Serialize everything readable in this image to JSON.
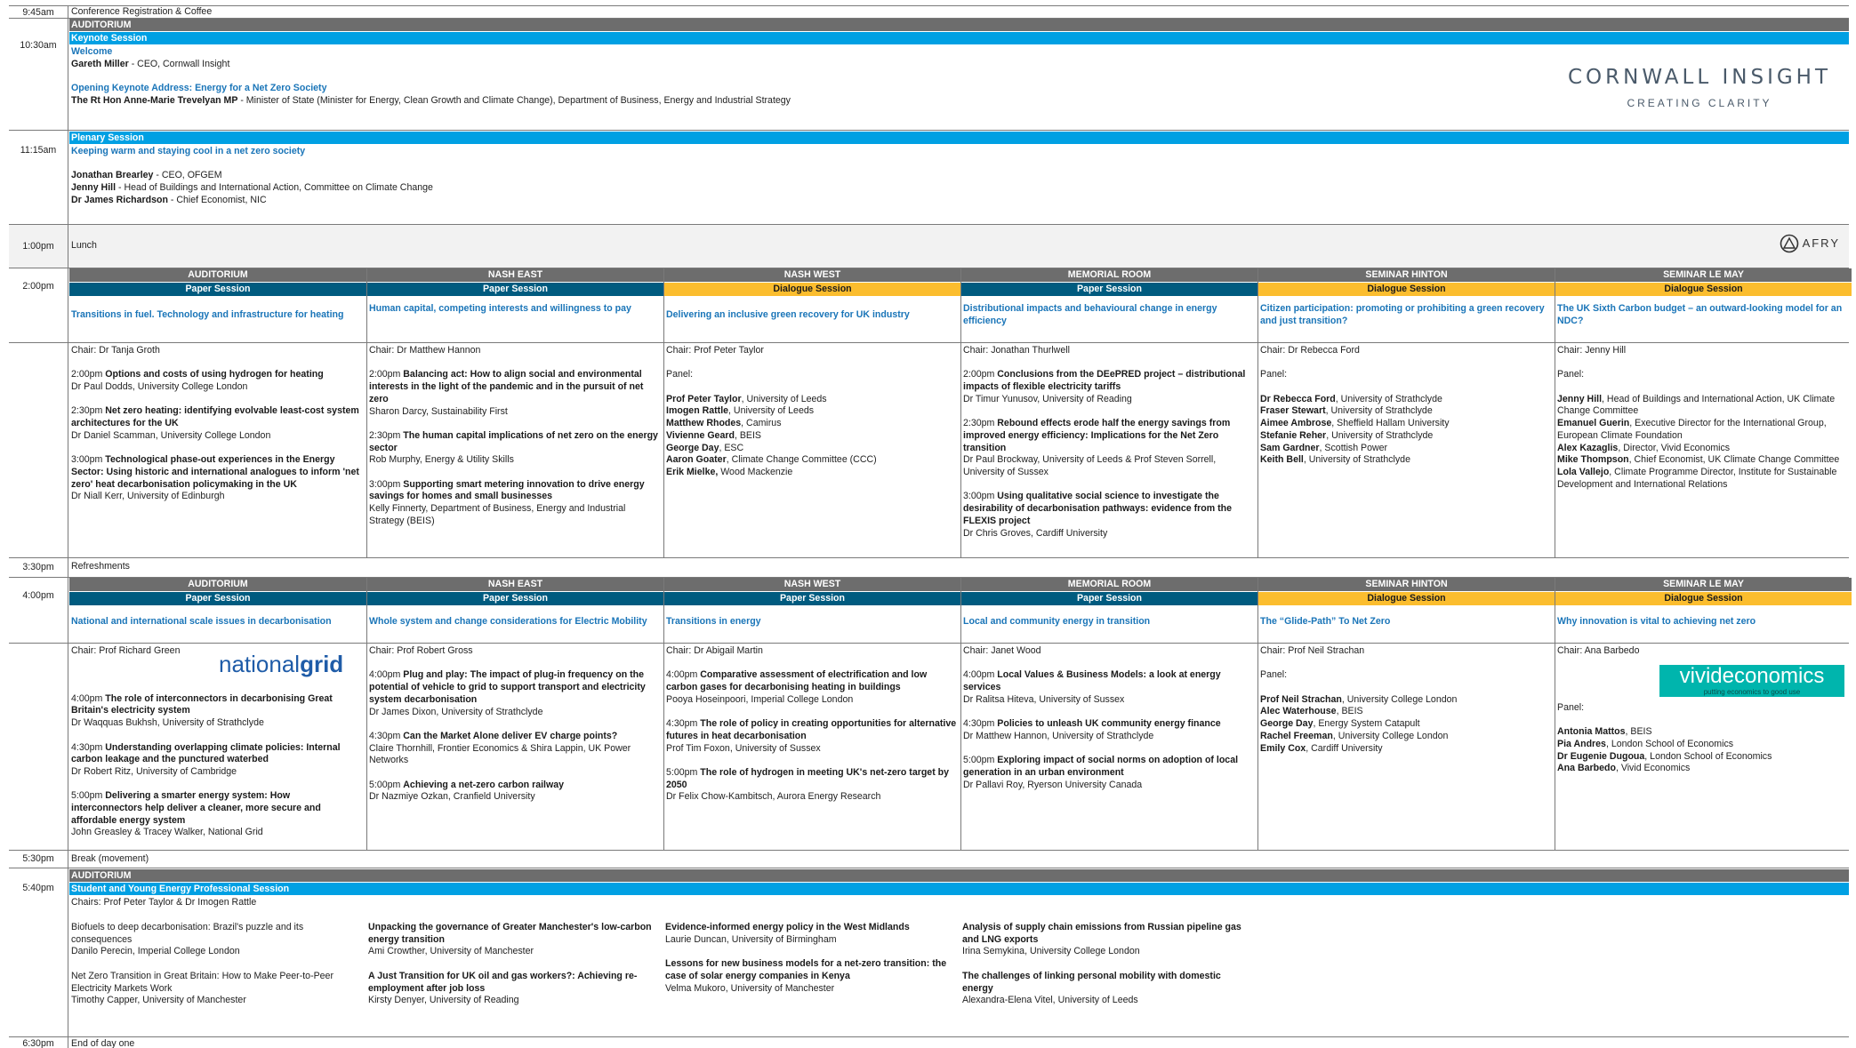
{
  "colors": {
    "grey": "#6d6d6d",
    "blue": "#00a0e3",
    "teal": "#005b7f",
    "gold": "#fbbd2e",
    "title_blue": "#1a75b8"
  },
  "logos": {
    "cornwall": {
      "line1": "CORNWALL INSIGHT",
      "line2": "CREATING CLARITY"
    },
    "afry": "AFRY",
    "nationalgrid": {
      "a": "national",
      "b": "grid"
    },
    "vivid": {
      "a": "vivideconomics",
      "b": "putting economics to good use"
    }
  },
  "times": [
    "9:45am",
    "10:30am",
    "11:15am",
    "1:00pm",
    "2:00pm",
    "3:30pm",
    "4:00pm",
    "5:30pm",
    "5:40pm",
    "6:30pm"
  ],
  "simple": {
    "registration": "Conference Registration & Coffee",
    "lunch": "Lunch",
    "refreshments": "Refreshments",
    "break": "Break (movement)",
    "end": "End of day one"
  },
  "keynote": {
    "room": "AUDITORIUM",
    "session": "Keynote Session",
    "welcome": "Welcome",
    "s1_name": "Gareth Miller",
    "s1_role": " - CEO, Cornwall Insight",
    "address": "Opening Keynote Address: Energy for a Net Zero Society",
    "s2_name": "The Rt Hon Anne-Marie Trevelyan MP",
    "s2_role": " - Minister of State (Minister for Energy, Clean Growth and Climate Change), Department of Business, Energy and Industrial Strategy"
  },
  "plenary": {
    "session": "Plenary Session",
    "title": "Keeping warm and staying cool in a net zero society",
    "p1_name": "Jonathan Brearley",
    "p1_role": " - CEO, OFGEM",
    "p2_name": "Jenny Hill",
    "p2_role": " - Head of Buildings and International Action, Committee on Climate Change",
    "p3_name": "Dr James Richardson",
    "p3_role": " - Chief Economist, NIC"
  },
  "rooms": [
    "AUDITORIUM",
    "NASH EAST",
    "NASH WEST",
    "MEMORIAL ROOM",
    "SEMINAR HINTON",
    "SEMINAR LE MAY"
  ],
  "s2": {
    "types": [
      "Paper Session",
      "Paper Session",
      "Dialogue Session",
      "Paper Session",
      "Dialogue Session",
      "Dialogue Session"
    ],
    "titles": [
      "Transitions in fuel. Technology and infrastructure for heating",
      "Human capital, competing interests and willingness to pay",
      "Delivering an inclusive green recovery for UK industry",
      "Distributional impacts and behavioural change in energy efficiency",
      "Citizen participation: promoting or prohibiting a green recovery and just transition?",
      "The UK Sixth Carbon budget – an outward-looking model for an NDC?"
    ],
    "c0": {
      "chair": "Chair: Dr Tanja Groth",
      "a1": "2:00pm ",
      "a1b": "Options and costs of using hydrogen for heating",
      "a1s": "Dr Paul Dodds, University College London",
      "a2": "2:30pm ",
      "a2b": "Net zero heating: identifying evolvable least-cost system architectures for the UK",
      "a2s": "Dr Daniel Scamman, University College London",
      "a3": "3:00pm ",
      "a3b": "Technological phase-out experiences in the Energy Sector: Using historic and international analogues to inform 'net zero' heat decarbonisation policymaking in the UK",
      "a3s": "Dr Niall Kerr, University of Edinburgh"
    },
    "c1": {
      "chair": "Chair: Dr Matthew Hannon",
      "a1": "2:00pm ",
      "a1b": "Balancing act: How to align social and environmental interests in the light of the pandemic and in the pursuit of net zero",
      "a1s": "Sharon Darcy, Sustainability First",
      "a2": "2:30pm ",
      "a2b": "The human capital implications of net zero on the energy sector",
      "a2s": "Rob Murphy, Energy & Utility Skills",
      "a3": "3:00pm ",
      "a3b": "Supporting smart metering innovation to drive energy savings for homes and small businesses",
      "a3s": "Kelly Finnerty, Department of Business, Energy and Industrial Strategy (BEIS)"
    },
    "c2": {
      "chair": "Chair: Prof Peter Taylor",
      "panel": "Panel:",
      "m": [
        [
          "Prof Peter Taylor",
          ", University of Leeds"
        ],
        [
          "Imogen Rattle",
          ", University of Leeds"
        ],
        [
          "Matthew Rhodes",
          ", Camirus"
        ],
        [
          "Vivienne Geard",
          ", BEIS"
        ],
        [
          "George Day",
          ", ESC"
        ],
        [
          "Aaron Goater",
          ", Climate Change Committee (CCC)"
        ],
        [
          "Erik Mielke,",
          " Wood Mackenzie"
        ]
      ]
    },
    "c3": {
      "chair": "Chair: Jonathan Thurlwell",
      "a1": "2:00pm ",
      "a1b": "Conclusions from the DEePRED project – distributional impacts of flexible electricity tariffs",
      "a1s": "Dr Timur Yunusov, University of Reading",
      "a2": "2:30pm ",
      "a2b": "Rebound effects erode half the energy savings from improved energy efficiency: Implications for the Net Zero transition",
      "a2s": "Dr Paul Brockway, University of Leeds & Prof Steven Sorrell, University of Sussex",
      "a3": "3:00pm ",
      "a3b": "Using qualitative social science to investigate the desirability of decarbonisation pathways: evidence from the FLEXIS project",
      "a3s": "Dr Chris Groves, Cardiff University"
    },
    "c4": {
      "chair": "Chair: Dr Rebecca Ford",
      "panel": "Panel:",
      "m": [
        [
          "Dr Rebecca Ford",
          ", University of Strathclyde"
        ],
        [
          "Fraser Stewart",
          ", University of Strathclyde"
        ],
        [
          "Aimee Ambrose",
          ", Sheffield Hallam University"
        ],
        [
          "Stefanie Reher",
          ", University of Strathclyde"
        ],
        [
          "Sam Gardner",
          ", Scottish Power"
        ],
        [
          "Keith Bell",
          ", University of Strathclyde"
        ]
      ]
    },
    "c5": {
      "chair": "Chair: Jenny Hill",
      "panel": "Panel:",
      "m": [
        [
          "Jenny Hill",
          ", Head of Buildings and International Action, UK Climate Change Committee"
        ],
        [
          "Emanuel Guerin",
          ", Executive Director for the International Group, European Climate Foundation"
        ],
        [
          "Alex Kazaglis",
          ", Director, Vivid Economics"
        ],
        [
          "Mike Thompson",
          ", Chief Economist, UK Climate Change Committee"
        ],
        [
          "Lola Vallejo",
          ", Climate Programme Director, Institute for Sustainable Development and International Relations"
        ]
      ]
    }
  },
  "s4": {
    "types": [
      "Paper Session",
      "Paper Session",
      "Paper Session",
      "Paper Session",
      "Dialogue Session",
      "Dialogue Session"
    ],
    "titles": [
      "National and international scale issues in decarbonisation",
      "Whole system and change considerations for Electric Mobility",
      "Transitions in energy",
      "Local and community energy in transition",
      "The “Glide-Path” To Net Zero",
      "Why innovation is vital to achieving net zero"
    ],
    "c0": {
      "chair": "Chair: Prof Richard Green",
      "a1": "4:00pm ",
      "a1b": "The role of interconnectors in decarbonising Great Britain's electricity system",
      "a1s": "Dr Waqquas Bukhsh, University of Strathclyde",
      "a2": "4:30pm ",
      "a2b": "Understanding overlapping climate policies: Internal carbon leakage and the punctured waterbed",
      "a2s": "Dr Robert Ritz, University of Cambridge",
      "a3": "5:00pm ",
      "a3b": "Delivering a smarter energy system: How interconnectors help deliver a cleaner, more secure and affordable energy system",
      "a3s": "John Greasley & Tracey Walker, National Grid"
    },
    "c1": {
      "chair": "Chair: Prof Robert Gross",
      "a1": "4:00pm ",
      "a1b": "Plug and play: The impact of plug-in frequency on the potential of vehicle to grid to support transport and electricity system decarbonisation",
      "a1s": "Dr James Dixon, University of Strathclyde",
      "a2": "4:30pm ",
      "a2b": "Can the Market Alone deliver EV charge points?",
      "a2s": "Claire Thornhill, Frontier Economics & Shira Lappin, UK Power Networks",
      "a3": "5:00pm ",
      "a3b": "Achieving a net-zero carbon railway",
      "a3s": "Dr Nazmiye Ozkan, Cranfield University"
    },
    "c2": {
      "chair": "Chair: Dr Abigail Martin",
      "a1": "4:00pm ",
      "a1b": "Comparative assessment of electrification and low carbon gases for decarbonising heating in buildings",
      "a1s": "Pooya Hoseinpoori, Imperial College London",
      "a2": "4:30pm ",
      "a2b": "The role of policy in creating opportunities for alternative futures in heat decarbonisation",
      "a2s": "Prof Tim Foxon, University of Sussex",
      "a3": "5:00pm ",
      "a3b": "The role of hydrogen in meeting UK's net-zero target by 2050",
      "a3s": "Dr Felix Chow-Kambitsch, Aurora Energy Research"
    },
    "c3": {
      "chair": "Chair: Janet Wood",
      "a1": "4:00pm ",
      "a1b": "Local Values & Business Models: a look at energy services",
      "a1s": "Dr Ralitsa Hiteva, University of Sussex",
      "a2": "4:30pm ",
      "a2b": "Policies to unleash UK community energy finance",
      "a2s": "Dr Matthew Hannon, University of Strathclyde",
      "a3": "5:00pm ",
      "a3b": "Exploring impact of social norms on adoption of local generation in an urban environment",
      "a3s": "Dr Pallavi Roy, Ryerson University Canada"
    },
    "c4": {
      "chair": "Chair: Prof Neil Strachan",
      "panel": "Panel:",
      "m": [
        [
          "Prof Neil Strachan",
          ", University College London"
        ],
        [
          "Alec Waterhouse",
          ", BEIS"
        ],
        [
          "George Day",
          ", Energy System Catapult"
        ],
        [
          "Rachel Freeman",
          ", University College London"
        ],
        [
          "Emily Cox",
          ", Cardiff University"
        ]
      ]
    },
    "c5": {
      "chair": "Chair: Ana Barbedo",
      "panel": "Panel:",
      "m": [
        [
          "Antonia Mattos",
          ", BEIS"
        ],
        [
          "Pia Andres",
          ", London School of Economics"
        ],
        [
          "Dr Eugenie Dugoua",
          ", London School of Economics"
        ],
        [
          "Ana Barbedo",
          ", Vivid Economics"
        ]
      ]
    }
  },
  "student": {
    "room": "AUDITORIUM",
    "session": "Student and Young Energy Professional Session",
    "chairs": "Chairs: Prof Peter Taylor & Dr Imogen Rattle",
    "a": [
      {
        "t": "Biofuels to deep decarbonisation: Brazil's puzzle and its consequences",
        "s": "Danilo Perecin, Imperial College London"
      },
      {
        "t": "Net Zero Transition in Great Britain: How to Make Peer-to-Peer Electricity Markets Work",
        "s": "Timothy Capper, University of Manchester"
      }
    ],
    "b": [
      {
        "t": "Unpacking the governance of Greater Manchester's low-carbon energy transition",
        "s": "Ami Crowther, University of Manchester"
      },
      {
        "t": "A Just Transition for UK oil and gas workers?: Achieving re-employment after job loss",
        "s": "Kirsty Denyer, University of Reading"
      }
    ],
    "c": [
      {
        "t": "Evidence-informed energy policy in the West Midlands",
        "s": "Laurie Duncan, University of Birmingham"
      },
      {
        "t": "Lessons for new business models for a net-zero transition: the case of solar energy companies in Kenya",
        "s": "Velma Mukoro, University of Manchester"
      }
    ],
    "d": [
      {
        "t": "Analysis of supply chain emissions from Russian pipeline gas and LNG exports",
        "s": "Irina Semykina, University College London"
      },
      {
        "t": "The challenges of linking personal mobility with domestic energy",
        "s": "Alexandra-Elena Vitel, University of Leeds"
      }
    ]
  }
}
